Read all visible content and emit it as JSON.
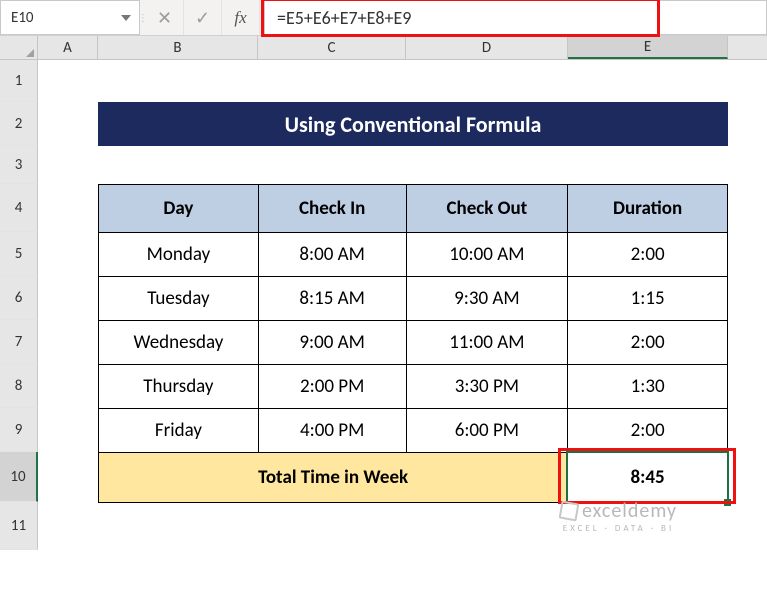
{
  "name_box": "E10",
  "formula": "=E5+E6+E7+E8+E9",
  "columns": [
    "A",
    "B",
    "C",
    "D",
    "E"
  ],
  "rows": [
    "1",
    "2",
    "3",
    "4",
    "5",
    "6",
    "7",
    "8",
    "9",
    "10",
    "11"
  ],
  "title": "Using Conventional Formula",
  "headers": {
    "day": "Day",
    "checkin": "Check In",
    "checkout": "Check Out",
    "duration": "Duration"
  },
  "data_rows": [
    {
      "day": "Monday",
      "in": "8:00 AM",
      "out": "10:00 AM",
      "dur": "2:00"
    },
    {
      "day": "Tuesday",
      "in": "8:15 AM",
      "out": "9:30 AM",
      "dur": "1:15"
    },
    {
      "day": "Wednesday",
      "in": "9:00 AM",
      "out": "11:00 AM",
      "dur": "2:00"
    },
    {
      "day": "Thursday",
      "in": "2:00 PM",
      "out": "3:30 PM",
      "dur": "1:30"
    },
    {
      "day": "Friday",
      "in": "4:00 PM",
      "out": "6:00 PM",
      "dur": "2:00"
    }
  ],
  "total": {
    "label": "Total Time in Week",
    "value": "8:45"
  },
  "watermark": {
    "name": "exceldemy",
    "tag": "EXCEL · DATA · BI"
  },
  "chart_data": {
    "type": "table",
    "title": "Using Conventional Formula",
    "columns": [
      "Day",
      "Check In",
      "Check Out",
      "Duration"
    ],
    "rows": [
      [
        "Monday",
        "8:00 AM",
        "10:00 AM",
        "2:00"
      ],
      [
        "Tuesday",
        "8:15 AM",
        "9:30 AM",
        "1:15"
      ],
      [
        "Wednesday",
        "9:00 AM",
        "11:00 AM",
        "2:00"
      ],
      [
        "Thursday",
        "2:00 PM",
        "3:30 PM",
        "1:30"
      ],
      [
        "Friday",
        "4:00 PM",
        "6:00 PM",
        "2:00"
      ]
    ],
    "summary": {
      "label": "Total Time in Week",
      "value": "8:45",
      "formula": "=E5+E6+E7+E8+E9"
    }
  }
}
